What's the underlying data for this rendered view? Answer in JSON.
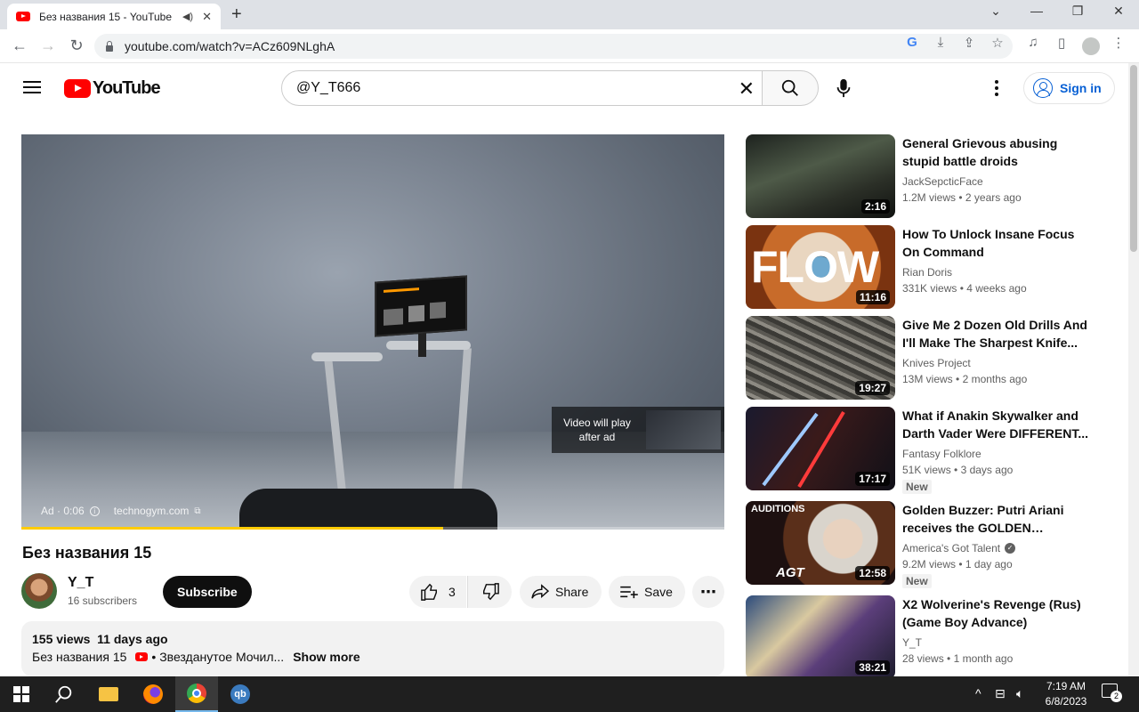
{
  "browser": {
    "tab_title": "Без названия 15 - YouTube",
    "url": "youtube.com/watch?v=ACz609NLghA"
  },
  "header": {
    "logo_text": "YouTube",
    "search_value": "@Y_T666",
    "sign_in_label": "Sign in"
  },
  "player": {
    "ad_label": "Ad · 0:06",
    "ad_domain": "technogym.com",
    "next_text": "Video will play after ad",
    "ad_progress_pct": 60
  },
  "video": {
    "title": "Без названия 15",
    "channel": "Y_T",
    "subscribers": "16 subscribers",
    "subscribe_label": "Subscribe",
    "likes": "3",
    "share_label": "Share",
    "save_label": "Save",
    "views": "155 views",
    "age": "11 days ago",
    "desc_text": "Без названия 15",
    "desc_link": "• Звезданутое Мочил...",
    "show_more": "Show more"
  },
  "recommendations": [
    {
      "title": "General Grievous abusing stupid battle droids",
      "channel": "JackSepcticFace",
      "views": "1.2M views",
      "age": "2 years ago",
      "duration": "2:16",
      "verified": false,
      "badge": ""
    },
    {
      "title": "How To Unlock Insane Focus On Command",
      "channel": "Rian Doris",
      "views": "331K views",
      "age": "4 weeks ago",
      "duration": "11:16",
      "verified": false,
      "badge": ""
    },
    {
      "title": "Give Me 2 Dozen Old Drills And I'll Make The Sharpest Knife...",
      "channel": "Knives Project",
      "views": "13M views",
      "age": "2 months ago",
      "duration": "19:27",
      "verified": false,
      "badge": ""
    },
    {
      "title": "What if Anakin Skywalker and Darth Vader Were DIFFERENT...",
      "channel": "Fantasy Folklore",
      "views": "51K views",
      "age": "3 days ago",
      "duration": "17:17",
      "verified": false,
      "badge": "New"
    },
    {
      "title": "Golden Buzzer: Putri Ariani receives the GOLDEN BUZZER...",
      "channel": "America's Got Talent",
      "views": "9.2M views",
      "age": "1 day ago",
      "duration": "12:58",
      "verified": true,
      "badge": "New"
    },
    {
      "title": "X2 Wolverine's Revenge (Rus) (Game Boy Advance)",
      "channel": "Y_T",
      "views": "28 views",
      "age": "1 month ago",
      "duration": "38:21",
      "verified": false,
      "badge": ""
    }
  ],
  "thumb_text": {
    "flow": "FLOW",
    "auditions": "AUDITIONS",
    "agt": "AGT"
  },
  "taskbar": {
    "time": "7:19 AM",
    "date": "6/8/2023",
    "notifications": "2"
  },
  "colors": {
    "yt_red": "#ff0000",
    "link_blue": "#065fd4",
    "ad_yellow": "#ffcc00"
  }
}
